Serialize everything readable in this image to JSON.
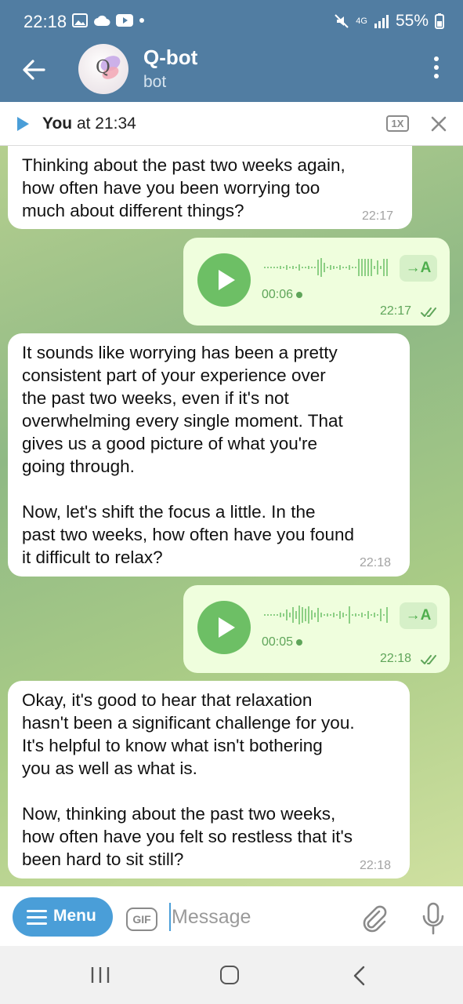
{
  "status_bar": {
    "time": "22:18",
    "battery": "55%",
    "network": "4G"
  },
  "header": {
    "title": "Q-bot",
    "subtitle": "bot",
    "avatar_letter": "Q"
  },
  "player_bar": {
    "author": "You",
    "when": "at 21:34",
    "speed": "1X"
  },
  "messages": [
    {
      "type": "text",
      "direction": "incoming",
      "text": "Thinking about the past two weeks again,\nhow often have you been worrying too\nmuch about different things?",
      "time": "22:17"
    },
    {
      "type": "voice",
      "direction": "outgoing",
      "duration": "00:06",
      "time": "22:17",
      "transcribe_label": "→A",
      "status": "read"
    },
    {
      "type": "text",
      "direction": "incoming",
      "text": "It sounds like worrying has been a pretty\nconsistent part of your experience over\nthe past two weeks, even if it's not\noverwhelming every single moment. That\ngives us a good picture of what you're\ngoing through.\n\nNow, let's shift the focus a little. In the\npast two weeks, how often have you found\nit difficult to relax?",
      "time": "22:18"
    },
    {
      "type": "voice",
      "direction": "outgoing",
      "duration": "00:05",
      "time": "22:18",
      "transcribe_label": "→A",
      "status": "read"
    },
    {
      "type": "text",
      "direction": "incoming",
      "text": "Okay, it's good to hear that relaxation\nhasn't been a significant challenge for you.\nIt's helpful to know what isn't bothering\nyou as well as what is.\n\nNow, thinking about the past two weeks,\nhow often have you felt so restless that it's\nbeen hard to sit still?",
      "time": "22:18"
    }
  ],
  "input_bar": {
    "menu_label": "Menu",
    "gif_label": "GIF",
    "placeholder": "Message"
  },
  "colors": {
    "header": "#517da2",
    "accent": "#4a9ed8",
    "outgoing_bubble": "#effedd",
    "play_button": "#6dbf65"
  },
  "icons": [
    "back-arrow-icon",
    "more-vertical-icon",
    "play-icon",
    "close-icon",
    "checkmarks-icon",
    "paperclip-icon",
    "microphone-icon",
    "hamburger-icon"
  ]
}
